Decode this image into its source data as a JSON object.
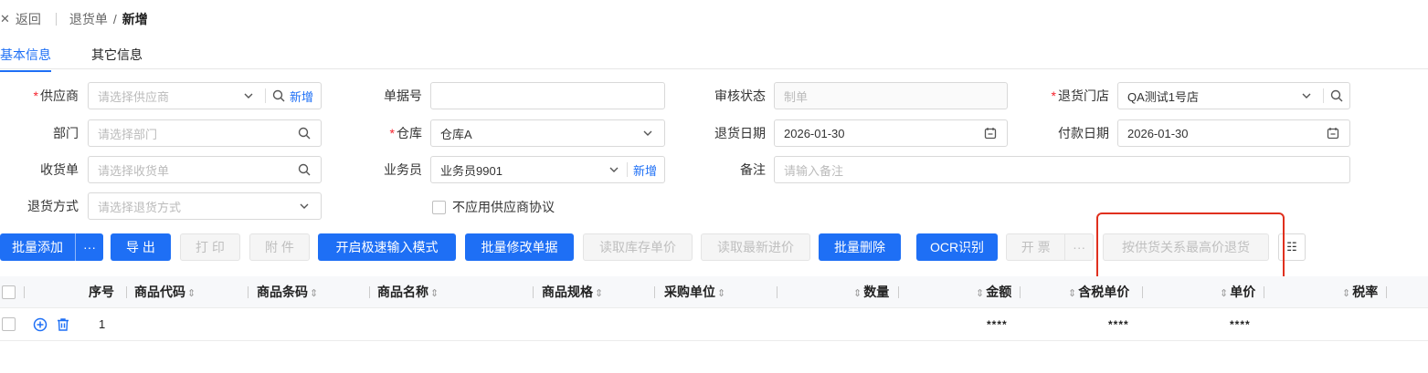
{
  "breadcrumb": {
    "back_label": "返回",
    "parent": "退货单",
    "current": "新增"
  },
  "tabs": [
    {
      "label": "基本信息"
    },
    {
      "label": "其它信息"
    }
  ],
  "form": {
    "supplier": {
      "label": "供应商",
      "placeholder": "请选择供应商",
      "link": "新增"
    },
    "doc_no": {
      "label": "单据号",
      "value": ""
    },
    "audit_status": {
      "label": "审核状态",
      "placeholder": "制单"
    },
    "return_store": {
      "label": "退货门店",
      "value": "QA测试1号店"
    },
    "department": {
      "label": "部门",
      "placeholder": "请选择部门"
    },
    "warehouse": {
      "label": "仓库",
      "value": "仓库A"
    },
    "return_date": {
      "label": "退货日期",
      "value": "2026-01-30"
    },
    "payment_date": {
      "label": "付款日期",
      "value": "2026-01-30"
    },
    "receipt": {
      "label": "收货单",
      "placeholder": "请选择收货单"
    },
    "salesperson": {
      "label": "业务员",
      "value": "业务员9901",
      "link": "新增"
    },
    "remark": {
      "label": "备注",
      "placeholder": "请输入备注"
    },
    "return_method": {
      "label": "退货方式",
      "placeholder": "请选择退货方式"
    },
    "no_supplier_agreement": {
      "label": "不应用供应商协议"
    }
  },
  "toolbar": {
    "batch_add": "批量添加",
    "more": "···",
    "export": "导 出",
    "print": "打 印",
    "attachment": "附 件",
    "quick_input": "开启极速输入模式",
    "batch_modify": "批量修改单据",
    "read_stock_price": "读取库存单价",
    "read_latest_price": "读取最新进价",
    "batch_delete": "批量删除",
    "ocr": "OCR识别",
    "invoice": "开 票",
    "invoice_more": "···",
    "highest_price_return": "按供货关系最高价退货",
    "column_settings": "☷"
  },
  "table": {
    "headers": {
      "seq": "序号",
      "code": "商品代码",
      "barcode": "商品条码",
      "name": "商品名称",
      "spec": "商品规格",
      "unit": "采购单位",
      "qty": "数量",
      "amount": "金额",
      "tax_price": "含税单价",
      "price": "单价",
      "tax_rate": "税率"
    },
    "rows": [
      {
        "seq": "1",
        "amount": "****",
        "tax_price": "****",
        "price": "****"
      }
    ]
  },
  "colors": {
    "primary": "#1e6ff5",
    "required": "#f5222d",
    "highlight": "#e0301e"
  }
}
